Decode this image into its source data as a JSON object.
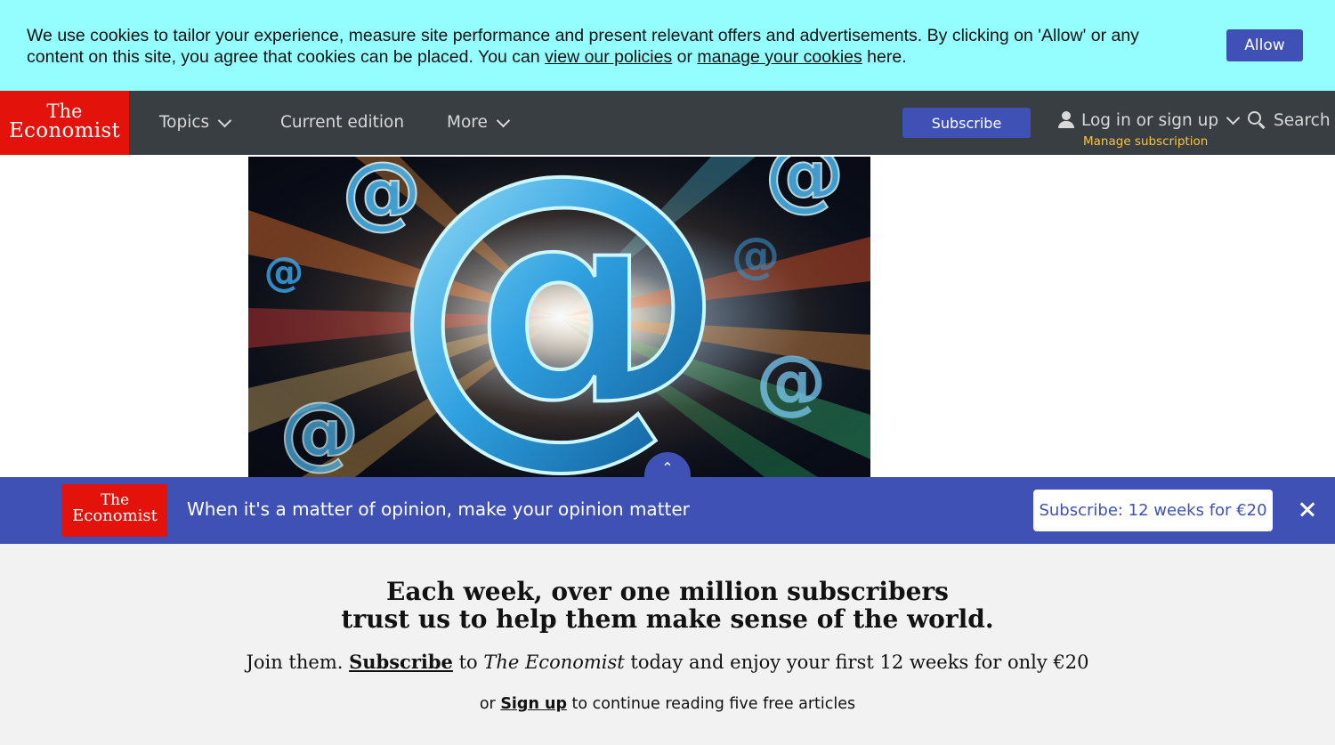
{
  "cookie_banner": {
    "text_1": "We use cookies to tailor your experience, measure site performance and present relevant offers and advertisements. By clicking on 'Allow' or any content on this site, you agree that cookies can be placed. You can ",
    "link_policies": "view our policies",
    "text_2": " or ",
    "link_manage": "manage your cookies",
    "text_3": " here.",
    "allow_label": "Allow"
  },
  "nav": {
    "logo_line1": "The",
    "logo_line2": "Economist",
    "topics": "Topics",
    "current_edition": "Current edition",
    "more": "More",
    "subscribe": "Subscribe",
    "login": "Log in or sign up",
    "manage_subscription": "Manage subscription",
    "search": "Search"
  },
  "hero": {
    "symbol": "@",
    "scroll_up": "⌃"
  },
  "subscribe_bar": {
    "logo_line1": "The",
    "logo_line2": "Economist",
    "tagline": "When it's a matter of opinion, make your opinion matter",
    "button": "Subscribe: 12 weeks for €20",
    "close_icon": "close-icon"
  },
  "paywall": {
    "heading_line1": "Each week, over one million subscribers",
    "heading_line2": "trust us to help them make sense of the world.",
    "join_1": "Join them. ",
    "subscribe_link": "Subscribe",
    "join_2": " to ",
    "publication": "The Economist",
    "join_3": " today and enjoy your first 12 weeks for only €20",
    "or_1": "or ",
    "signup_link": "Sign up",
    "or_2": " to continue reading five free articles"
  },
  "colors": {
    "cookie_bg": "#94fdfe",
    "nav_bg": "#383e42",
    "brand_red": "#e3120b",
    "accent_blue": "#3f51b5",
    "manage_yellow": "#f9c440",
    "paywall_bg": "#f2f2f2"
  }
}
